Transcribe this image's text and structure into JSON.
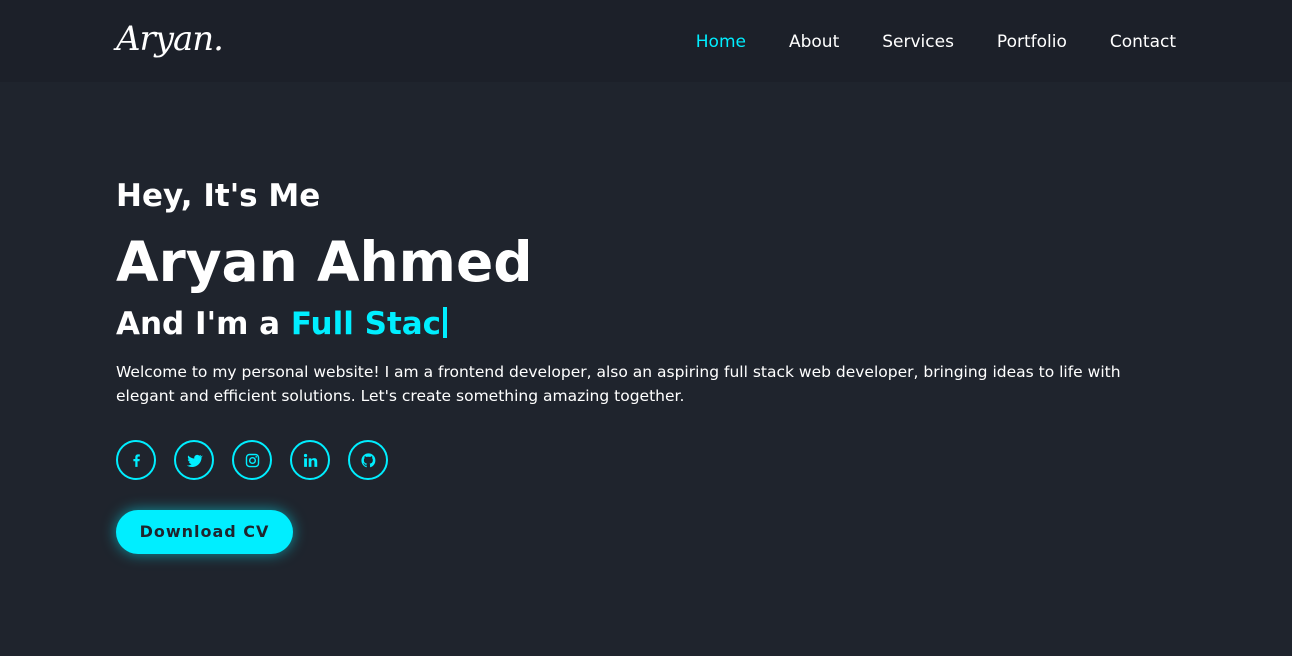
{
  "header": {
    "logo_text": "Aryan.",
    "nav": [
      {
        "label": "Home",
        "active": true
      },
      {
        "label": "About",
        "active": false
      },
      {
        "label": "Services",
        "active": false
      },
      {
        "label": "Portfolio",
        "active": false
      },
      {
        "label": "Contact",
        "active": false
      }
    ]
  },
  "hero": {
    "greeting": "Hey, It's Me",
    "name": "Aryan Ahmed",
    "role_prefix": "And I'm a ",
    "role_typed": "Full Stac",
    "intro": "Welcome to my personal website! I am a frontend developer, also an aspiring full stack web developer, bringing ideas to life with elegant and efficient solutions. Let's create something amazing together.",
    "socials": [
      {
        "icon": "facebook-icon"
      },
      {
        "icon": "twitter-icon"
      },
      {
        "icon": "instagram-icon"
      },
      {
        "icon": "linkedin-icon"
      },
      {
        "icon": "github-icon"
      }
    ],
    "cta_label": "Download CV"
  },
  "colors": {
    "background": "#1f242d",
    "header_background": "#1c2029",
    "accent": "#00eeff",
    "text": "#ffffff"
  }
}
